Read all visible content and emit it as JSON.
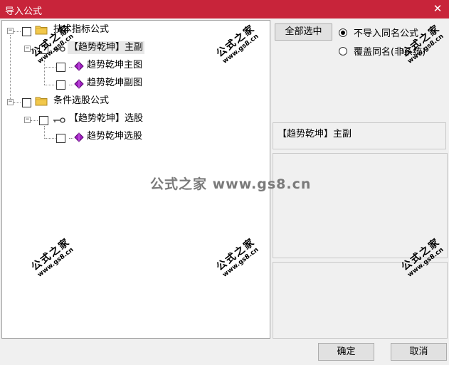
{
  "window": {
    "title": "导入公式",
    "close_glyph": "✕"
  },
  "tree": {
    "nodes": [
      {
        "id": "tech-folder",
        "label": "技术指标公式"
      },
      {
        "id": "tech-group",
        "label": "【趋势乾坤】主副"
      },
      {
        "id": "tech-main",
        "label": "趋势乾坤主图"
      },
      {
        "id": "tech-sub",
        "label": "趋势乾坤副图"
      },
      {
        "id": "cond-folder",
        "label": "条件选股公式"
      },
      {
        "id": "cond-group",
        "label": "【趋势乾坤】选股"
      },
      {
        "id": "cond-item",
        "label": "趋势乾坤选股"
      }
    ]
  },
  "buttons": {
    "select_all": "全部选中",
    "ok": "确定",
    "cancel": "取消"
  },
  "options": {
    "no_import_same": "不导入同名公式",
    "overwrite_same": "覆盖同名(非系统)",
    "selected": "no_import_same"
  },
  "info": {
    "selected_name": "【趋势乾坤】主副"
  },
  "watermark": {
    "brand": "公式之家",
    "url": "www.gs8.cn",
    "center_text": "公式之家 www.gs8.cn"
  },
  "icons": {
    "folder": "folder-icon",
    "key": "key-icon",
    "formula": "formula-icon"
  },
  "colors": {
    "titlebar": "#c8243a",
    "folder": "#f2c84b",
    "formula": "#a020c0"
  }
}
